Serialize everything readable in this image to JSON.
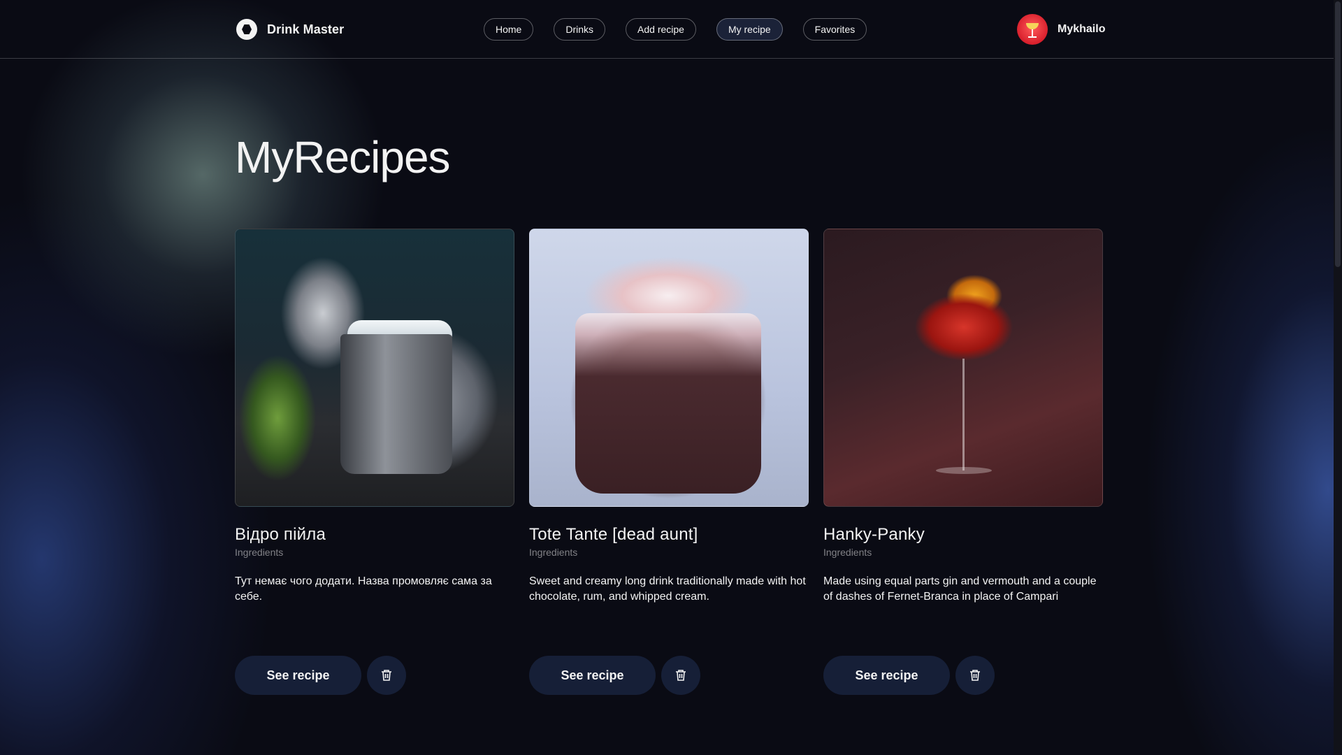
{
  "brand": {
    "name": "Drink Master",
    "icon": "logo-hexagon-icon"
  },
  "nav": [
    {
      "label": "Home",
      "active": false
    },
    {
      "label": "Drinks",
      "active": false
    },
    {
      "label": "Add recipe",
      "active": false
    },
    {
      "label": "My recipe",
      "active": true
    },
    {
      "label": "Favorites",
      "active": false
    }
  ],
  "user": {
    "name": "Mykhailo",
    "avatar_icon": "cocktail-avatar-icon"
  },
  "page": {
    "title": "MyRecipes"
  },
  "recipes": [
    {
      "name": "Відро пійла",
      "subtitle": "Ingredients",
      "description": "Тут немає чого додати. Назва промовляє сама за себе.",
      "see_label": "See recipe",
      "delete_icon": "trash-icon"
    },
    {
      "name": "Tote Tante [dead aunt]",
      "subtitle": "Ingredients",
      "description": "Sweet and creamy long drink traditionally made with hot chocolate, rum, and whipped cream.",
      "see_label": "See recipe",
      "delete_icon": "trash-icon"
    },
    {
      "name": "Hanky-Panky",
      "subtitle": "Ingredients",
      "description": "Made using equal parts gin and vermouth and a couple of dashes of Fernet-Branca in place of Campari",
      "see_label": "See recipe",
      "delete_icon": "trash-icon"
    }
  ],
  "colors": {
    "background": "#0a0b14",
    "text": "#f3f3f3",
    "button": "#161f37",
    "active_nav": "#1b2238",
    "avatar": "#d81f2c"
  }
}
